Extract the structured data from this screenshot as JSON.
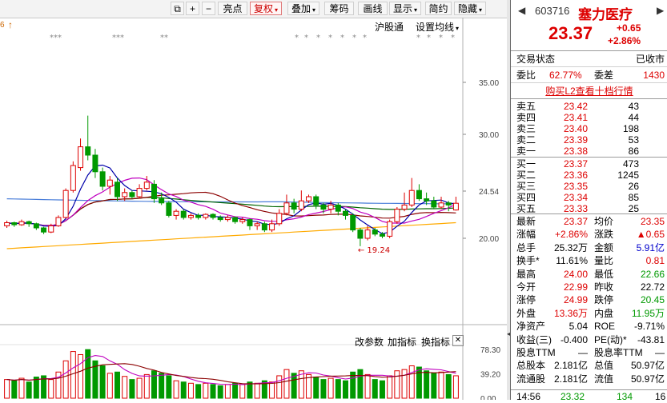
{
  "toolbar": {
    "arrow_left": "6",
    "arrow_up": "↑",
    "buttons": [
      {
        "label": "⧉"
      },
      {
        "label": "+"
      },
      {
        "label": "−"
      },
      {
        "label": "亮点"
      },
      {
        "label": "复权",
        "dd": "▾",
        "active": true
      },
      {
        "label": "叠加",
        "dd": "▾"
      },
      {
        "label": "筹码"
      },
      {
        "label": "画线"
      },
      {
        "label": "显示",
        "dd": "▾"
      },
      {
        "label": "简约"
      },
      {
        "label": "隐藏",
        "dd": "▾"
      }
    ],
    "hgt_label": "沪股通",
    "settings_label": "设置均线",
    "settings_dd": "▾"
  },
  "chart": {
    "price_ticks": [
      "35.00",
      "30.00",
      "24.54",
      "20.00"
    ],
    "low_marker": "19.24",
    "low_arrow": "←",
    "star_marks": [
      "***",
      "***",
      "**",
      "*",
      "*",
      "*",
      "*",
      "*",
      "*",
      "*",
      "*",
      "*",
      "*",
      "*"
    ],
    "sub_header": {
      "params": "改参数",
      "add": "加指标",
      "switch": "换指标",
      "close": "✕"
    },
    "vol_ticks": [
      "78.30",
      "39.20",
      "0.00"
    ]
  },
  "chart_data": {
    "type": "candlestick",
    "price_axis_ticks": [
      35.0,
      30.0,
      24.54,
      20.0
    ],
    "volume_axis_ticks": [
      78.3,
      39.2,
      0.0
    ],
    "candles": [
      {
        "o": 21.2,
        "c": 21.5,
        "h": 21.7,
        "l": 21.0
      },
      {
        "o": 21.5,
        "c": 21.3,
        "h": 21.6,
        "l": 21.1
      },
      {
        "o": 21.3,
        "c": 21.6,
        "h": 21.8,
        "l": 21.2
      },
      {
        "o": 21.6,
        "c": 21.4,
        "h": 21.7,
        "l": 21.1
      },
      {
        "o": 21.4,
        "c": 21.0,
        "h": 21.5,
        "l": 20.8
      },
      {
        "o": 21.0,
        "c": 20.6,
        "h": 21.1,
        "l": 20.4
      },
      {
        "o": 20.6,
        "c": 21.2,
        "h": 21.4,
        "l": 20.5
      },
      {
        "o": 21.2,
        "c": 22.0,
        "h": 22.2,
        "l": 21.1
      },
      {
        "o": 22.0,
        "c": 24.6,
        "h": 24.8,
        "l": 21.9
      },
      {
        "o": 24.6,
        "c": 27.0,
        "h": 27.4,
        "l": 24.4
      },
      {
        "o": 26.8,
        "c": 28.8,
        "h": 29.6,
        "l": 26.5
      },
      {
        "o": 28.8,
        "c": 28.0,
        "h": 31.8,
        "l": 27.5
      },
      {
        "o": 28.0,
        "c": 26.4,
        "h": 28.6,
        "l": 25.8
      },
      {
        "o": 26.4,
        "c": 25.0,
        "h": 26.8,
        "l": 24.6
      },
      {
        "o": 25.0,
        "c": 25.6,
        "h": 26.0,
        "l": 24.2
      },
      {
        "o": 25.4,
        "c": 24.0,
        "h": 25.8,
        "l": 23.6
      },
      {
        "o": 24.0,
        "c": 24.4,
        "h": 24.8,
        "l": 23.6
      },
      {
        "o": 24.4,
        "c": 24.0,
        "h": 24.6,
        "l": 23.8
      },
      {
        "o": 24.0,
        "c": 24.8,
        "h": 25.2,
        "l": 23.8
      },
      {
        "o": 24.8,
        "c": 25.4,
        "h": 26.0,
        "l": 24.6
      },
      {
        "o": 25.2,
        "c": 23.8,
        "h": 25.6,
        "l": 23.4
      },
      {
        "o": 23.8,
        "c": 23.4,
        "h": 24.4,
        "l": 23.2
      },
      {
        "o": 23.4,
        "c": 22.2,
        "h": 23.6,
        "l": 22.0
      },
      {
        "o": 22.2,
        "c": 22.6,
        "h": 22.8,
        "l": 21.8
      },
      {
        "o": 22.6,
        "c": 22.0,
        "h": 22.8,
        "l": 21.8
      },
      {
        "o": 22.0,
        "c": 22.2,
        "h": 22.4,
        "l": 21.8
      },
      {
        "o": 22.2,
        "c": 22.0,
        "h": 22.4,
        "l": 21.8
      },
      {
        "o": 22.0,
        "c": 22.3,
        "h": 22.4,
        "l": 21.8
      },
      {
        "o": 22.3,
        "c": 22.0,
        "h": 22.4,
        "l": 21.8
      },
      {
        "o": 22.0,
        "c": 21.8,
        "h": 22.2,
        "l": 21.6
      },
      {
        "o": 21.8,
        "c": 22.0,
        "h": 22.2,
        "l": 21.6
      },
      {
        "o": 22.0,
        "c": 21.6,
        "h": 22.1,
        "l": 21.4
      },
      {
        "o": 21.6,
        "c": 21.8,
        "h": 22.0,
        "l": 21.4
      },
      {
        "o": 21.8,
        "c": 21.2,
        "h": 21.9,
        "l": 20.8
      },
      {
        "o": 21.2,
        "c": 21.4,
        "h": 21.6,
        "l": 20.8
      },
      {
        "o": 21.4,
        "c": 20.8,
        "h": 21.6,
        "l": 20.6
      },
      {
        "o": 20.8,
        "c": 21.4,
        "h": 21.8,
        "l": 20.6
      },
      {
        "o": 21.4,
        "c": 22.4,
        "h": 22.8,
        "l": 21.2
      },
      {
        "o": 22.4,
        "c": 23.4,
        "h": 24.2,
        "l": 22.2
      },
      {
        "o": 23.4,
        "c": 22.8,
        "h": 23.8,
        "l": 22.4
      },
      {
        "o": 22.8,
        "c": 23.6,
        "h": 24.6,
        "l": 22.6
      },
      {
        "o": 23.6,
        "c": 24.0,
        "h": 24.2,
        "l": 23.4
      },
      {
        "o": 24.0,
        "c": 23.2,
        "h": 24.2,
        "l": 22.8
      },
      {
        "o": 23.2,
        "c": 22.8,
        "h": 23.4,
        "l": 22.4
      },
      {
        "o": 22.8,
        "c": 23.2,
        "h": 23.6,
        "l": 22.4
      },
      {
        "o": 23.2,
        "c": 22.6,
        "h": 23.4,
        "l": 22.2
      },
      {
        "o": 22.6,
        "c": 22.2,
        "h": 22.8,
        "l": 21.8
      },
      {
        "o": 22.2,
        "c": 20.8,
        "h": 22.4,
        "l": 20.6
      },
      {
        "o": 20.8,
        "c": 20.0,
        "h": 21.0,
        "l": 19.24
      },
      {
        "o": 20.0,
        "c": 20.8,
        "h": 21.2,
        "l": 19.8
      },
      {
        "o": 20.8,
        "c": 20.4,
        "h": 21.0,
        "l": 20.2
      },
      {
        "o": 20.4,
        "c": 20.2,
        "h": 20.6,
        "l": 20.0
      },
      {
        "o": 20.2,
        "c": 21.6,
        "h": 21.8,
        "l": 20.0
      },
      {
        "o": 21.6,
        "c": 22.8,
        "h": 23.0,
        "l": 21.4
      },
      {
        "o": 22.8,
        "c": 23.2,
        "h": 24.4,
        "l": 22.6
      },
      {
        "o": 23.2,
        "c": 24.6,
        "h": 25.8,
        "l": 23.0
      },
      {
        "o": 24.6,
        "c": 23.8,
        "h": 25.2,
        "l": 23.6
      },
      {
        "o": 23.8,
        "c": 23.6,
        "h": 24.4,
        "l": 23.2
      },
      {
        "o": 23.6,
        "c": 23.0,
        "h": 24.0,
        "l": 22.8
      },
      {
        "o": 23.0,
        "c": 23.4,
        "h": 24.0,
        "l": 22.8
      },
      {
        "o": 23.4,
        "c": 23.2,
        "h": 23.6,
        "l": 22.6
      },
      {
        "o": 22.72,
        "c": 23.37,
        "h": 24.0,
        "l": 22.66
      }
    ],
    "volumes": [
      30,
      28,
      32,
      26,
      34,
      36,
      30,
      42,
      60,
      75,
      70,
      78,
      60,
      52,
      40,
      42,
      35,
      30,
      32,
      38,
      44,
      40,
      36,
      28,
      26,
      24,
      22,
      24,
      22,
      20,
      22,
      24,
      22,
      26,
      24,
      28,
      26,
      36,
      46,
      40,
      44,
      38,
      34,
      30,
      32,
      30,
      28,
      42,
      46,
      38,
      30,
      28,
      36,
      44,
      46,
      52,
      50,
      44,
      40,
      42,
      38,
      36
    ]
  },
  "panel": {
    "code": "603716",
    "name": "塞力医疗",
    "nav_left": "◀",
    "nav_right": "▶",
    "price": "23.37",
    "change": "+0.65",
    "change_pct": "+2.86%",
    "status_label": "交易状态",
    "status_value": "已收市",
    "wb_label": "委比",
    "wb_value": "62.77%",
    "wc_label": "委差",
    "wc_value": "1430",
    "l2_link": "购买L2查看十档行情",
    "asks": [
      {
        "label": "卖五",
        "price": "23.42",
        "vol": "43"
      },
      {
        "label": "卖四",
        "price": "23.41",
        "vol": "44"
      },
      {
        "label": "卖三",
        "price": "23.40",
        "vol": "198"
      },
      {
        "label": "卖二",
        "price": "23.39",
        "vol": "53"
      },
      {
        "label": "卖一",
        "price": "23.38",
        "vol": "86"
      }
    ],
    "bids": [
      {
        "label": "买一",
        "price": "23.37",
        "vol": "473"
      },
      {
        "label": "买二",
        "price": "23.36",
        "vol": "1245"
      },
      {
        "label": "买三",
        "price": "23.35",
        "vol": "26"
      },
      {
        "label": "买四",
        "price": "23.34",
        "vol": "85"
      },
      {
        "label": "买五",
        "price": "23.33",
        "vol": "25"
      }
    ],
    "stats": [
      {
        "l1": "最新",
        "v1": "23.37",
        "c1": "red",
        "l2": "均价",
        "v2": "23.35",
        "c2": "red"
      },
      {
        "l1": "涨幅",
        "v1": "+2.86%",
        "c1": "red",
        "l2": "涨跌",
        "v2": "▲0.65",
        "c2": "red"
      },
      {
        "l1": "总手",
        "v1": "25.32万",
        "c1": "black",
        "l2": "金额",
        "v2": "5.91亿",
        "c2": "blue"
      },
      {
        "l1": "换手*",
        "v1": "11.61%",
        "c1": "black",
        "l2": "量比",
        "v2": "0.81",
        "c2": "red"
      },
      {
        "l1": "最高",
        "v1": "24.00",
        "c1": "red",
        "l2": "最低",
        "v2": "22.66",
        "c2": "green"
      },
      {
        "l1": "今开",
        "v1": "22.99",
        "c1": "red",
        "l2": "昨收",
        "v2": "22.72",
        "c2": "black"
      },
      {
        "l1": "涨停",
        "v1": "24.99",
        "c1": "red",
        "l2": "跌停",
        "v2": "20.45",
        "c2": "green"
      },
      {
        "l1": "外盘",
        "v1": "13.36万",
        "c1": "red",
        "l2": "内盘",
        "v2": "11.95万",
        "c2": "green"
      },
      {
        "l1": "净资产",
        "v1": "5.04",
        "c1": "black",
        "l2": "ROE",
        "v2": "-9.71%",
        "c2": "black"
      },
      {
        "l1": "收益(三)",
        "v1": "-0.400",
        "c1": "black",
        "l2": "PE(动)*",
        "v2": "-43.81",
        "c2": "black"
      },
      {
        "l1": "股息TTM",
        "v1": "—",
        "c1": "black",
        "l2": "股息率TTM",
        "v2": "—",
        "c2": "black"
      },
      {
        "l1": "总股本",
        "v1": "2.181亿",
        "c1": "black",
        "l2": "总值",
        "v2": "50.97亿",
        "c2": "black"
      },
      {
        "l1": "流通股",
        "v1": "2.181亿",
        "c1": "black",
        "l2": "流值",
        "v2": "50.97亿",
        "c2": "black"
      }
    ],
    "tick": {
      "time": "14:56",
      "price": "23.32",
      "vol": "134",
      "num": "16"
    }
  },
  "colors": {
    "up": "#dd0000",
    "down": "#009900",
    "ma5": "#0000aa",
    "ma10": "#c000c0",
    "ma20": "#8b0000",
    "ma60": "#006400",
    "ma120": "#ffaa00",
    "ma250": "#4a7ed9"
  }
}
